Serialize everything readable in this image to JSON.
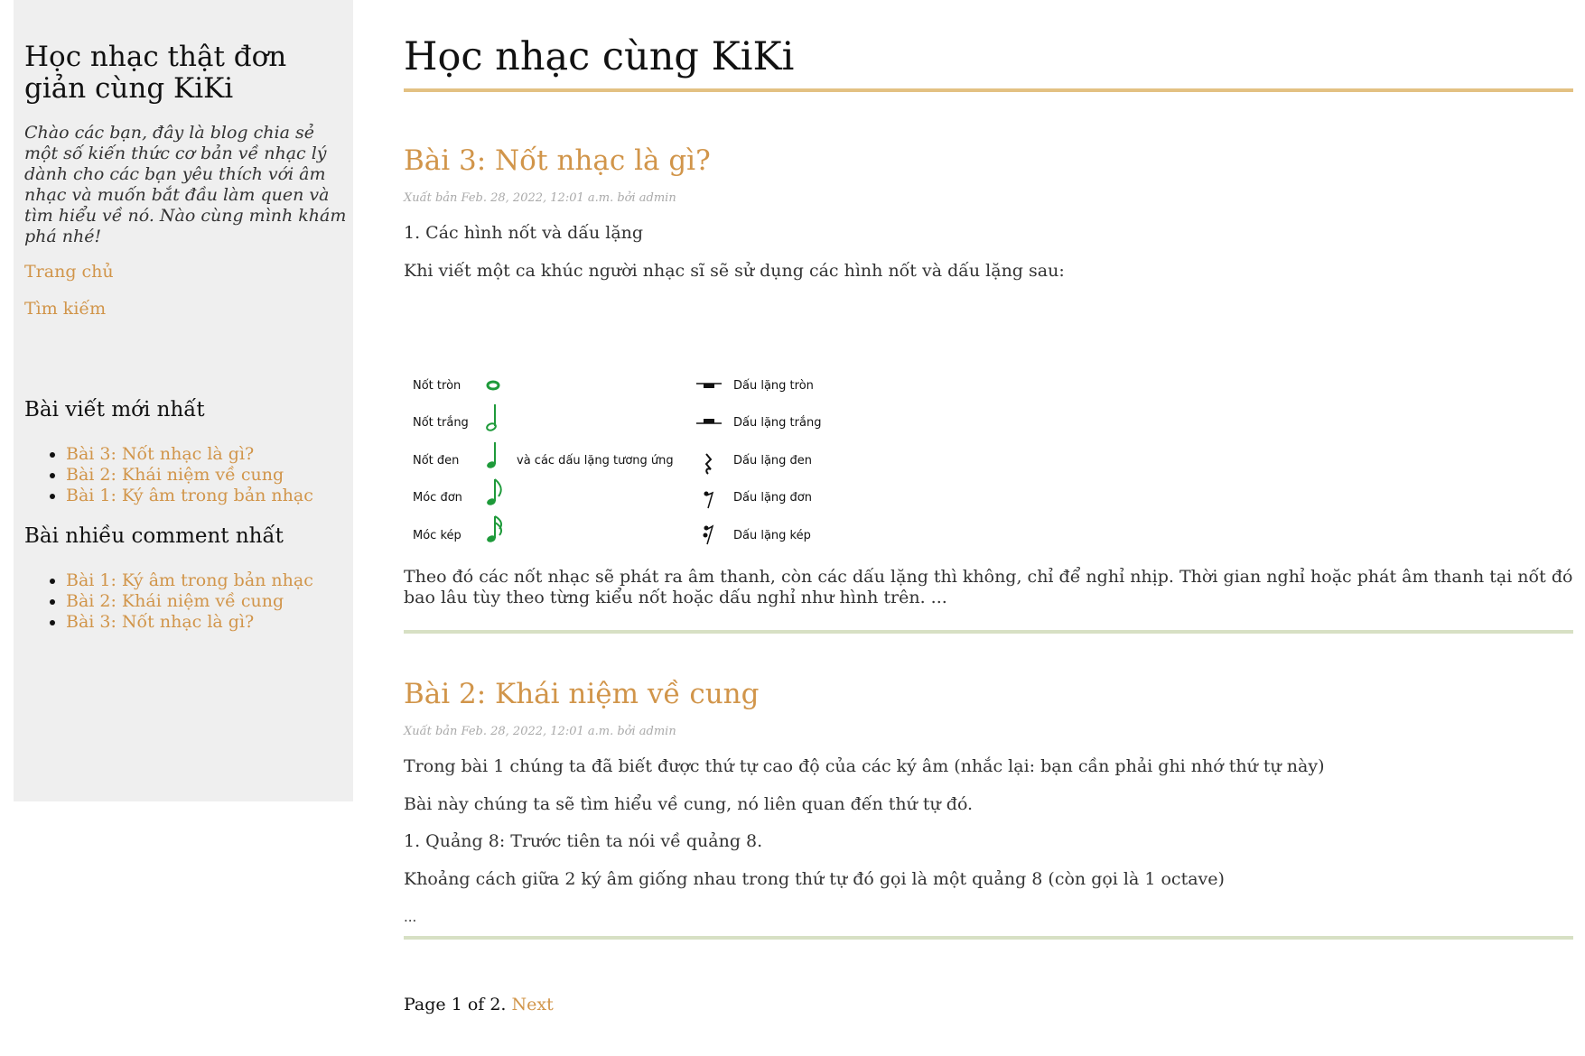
{
  "sidebar": {
    "site_title": "Học nhạc thật đơn giản cùng KiKi",
    "description": "Chào các bạn, đây là blog chia sẻ một số kiến thức cơ bản về nhạc lý dành cho các bạn yêu thích với âm nhạc và muốn bắt đầu làm quen và tìm hiểu về nó. Nào cùng mình khám phá nhé!",
    "nav": [
      "Trang chủ",
      "Tìm kiếm"
    ],
    "latest_heading": "Bài viết mới nhất",
    "latest": [
      "Bài 3: Nốt nhạc là gì?",
      "Bài 2: Khái niệm về cung",
      "Bài 1: Ký âm trong bản nhạc"
    ],
    "most_commented_heading": "Bài nhiều comment nhất",
    "most_commented": [
      "Bài 1: Ký âm trong bản nhạc",
      "Bài 2: Khái niệm về cung",
      "Bài 3: Nốt nhạc là gì?"
    ]
  },
  "main": {
    "blog_title": "Học nhạc cùng KiKi",
    "posts": [
      {
        "title": "Bài 3: Nốt nhạc là gì?",
        "meta": "Xuất bản Feb. 28, 2022, 12:01 a.m. bởi admin",
        "paragraphs": [
          "1. Các hình nốt và dấu lặng",
          "Khi viết một ca khúc người nhạc sĩ sẽ sử dụng các hình nốt và dấu lặng sau:"
        ],
        "figure": {
          "notes": [
            "Nốt tròn",
            "Nốt trắng",
            "Nốt đen",
            "Móc đơn",
            "Móc kép"
          ],
          "middle": "và các dấu lặng tương ứng",
          "rests": [
            "Dấu lặng tròn",
            "Dấu lặng trắng",
            "Dấu lặng đen",
            "Dấu lặng đơn",
            "Dấu lặng kép"
          ]
        },
        "summary": "Theo đó các nốt nhạc sẽ phát ra âm thanh, còn các dấu lặng thì không, chỉ để nghỉ nhịp. Thời gian nghỉ hoặc phát âm thanh tại nốt đó bao lâu tùy theo từng kiểu nốt hoặc dấu nghỉ như hình trên. ..."
      },
      {
        "title": "Bài 2: Khái niệm về cung",
        "meta": "Xuất bản Feb. 28, 2022, 12:01 a.m. bởi admin",
        "paragraphs": [
          "Trong bài 1 chúng ta đã biết được thứ tự cao độ của các ký âm (nhắc lại: bạn cần phải ghi nhớ thứ tự này)",
          "Bài này chúng ta sẽ tìm hiểu về cung, nó liên quan đến thứ tự đó.",
          "1. Quảng 8: Trước tiên ta nói về quảng 8.",
          "Khoảng cách giữa 2 ký âm giống nhau trong thứ tự đó gọi là một quảng 8 (còn gọi là 1 octave)",
          "..."
        ]
      }
    ],
    "pager": {
      "text": "Page 1 of 2.",
      "next": "Next"
    }
  },
  "colors": {
    "accent": "#d1954a",
    "sidebar_bg": "#efefef",
    "rule_orange": "#e3c183",
    "rule_green": "#d7e0c4",
    "note_green": "#1e9a3a"
  }
}
